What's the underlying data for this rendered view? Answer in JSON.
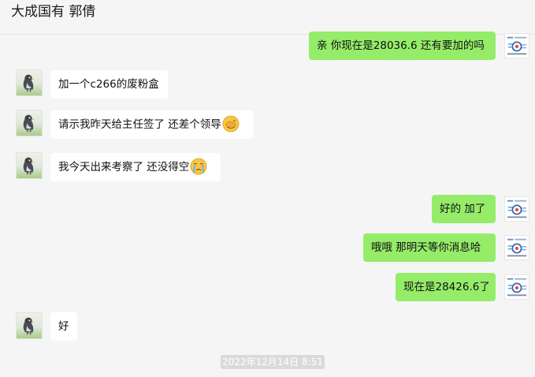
{
  "header": {
    "title": "大成国有 郭倩"
  },
  "messages": [
    {
      "side": "right",
      "text": "亲 你现在是28036.6 还有要加的吗"
    },
    {
      "side": "left",
      "text": "加一个c266的废粉盒"
    },
    {
      "side": "left",
      "text": "请示我昨天给主任签了 还差个领导",
      "emoji": "face-palm-emoji"
    },
    {
      "side": "left",
      "text": "我今天出来考察了 还没得空",
      "emoji": "crying-face-emoji"
    },
    {
      "side": "right",
      "text": "好的 加了"
    },
    {
      "side": "right",
      "text": "哦哦 那明天等你消息哈"
    },
    {
      "side": "right",
      "text": "现在是28426.6了"
    },
    {
      "side": "left",
      "text": "好"
    }
  ],
  "timestamp": "2022年12月14日 8:51",
  "colors": {
    "background": "#f5f5f5",
    "bubble_self": "#95ec69",
    "bubble_other": "#ffffff",
    "timestamp_bg": "#dadada"
  },
  "icons": {
    "contact_avatar": "cartoon-bird-avatar",
    "self_avatar": "company-logo-avatar"
  }
}
